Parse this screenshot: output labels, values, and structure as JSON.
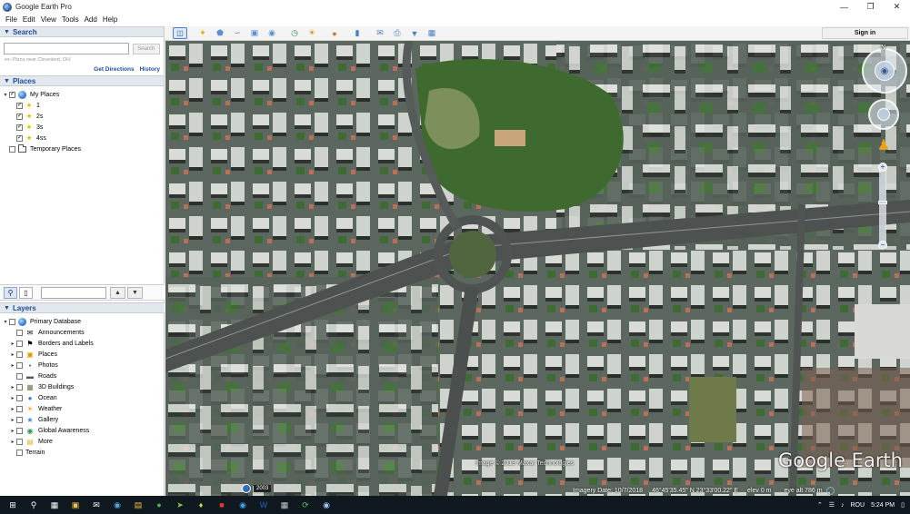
{
  "window": {
    "title": "Google Earth Pro",
    "controls": {
      "minimize": "—",
      "maximize": "❐",
      "close": "✕"
    }
  },
  "menu": [
    "File",
    "Edit",
    "View",
    "Tools",
    "Add",
    "Help"
  ],
  "search": {
    "header": "Search",
    "placeholder": "",
    "button": "Search",
    "hint": "ex: Pizza near Cleveland, OH",
    "get_directions": "Get Directions",
    "history": "History"
  },
  "places": {
    "header": "Places",
    "my_places": "My Places",
    "items": [
      {
        "label": "1",
        "checked": true
      },
      {
        "label": "2s",
        "checked": true
      },
      {
        "label": "3s",
        "checked": true
      },
      {
        "label": "4ss",
        "checked": true
      }
    ],
    "temporary": "Temporary Places"
  },
  "layers": {
    "header": "Layers",
    "primary": "Primary Database",
    "items": [
      {
        "label": "Announcements",
        "icon": "envelope-icon",
        "glyph": "✉"
      },
      {
        "label": "Borders and Labels",
        "icon": "flag-icon",
        "glyph": "⚑"
      },
      {
        "label": "Places",
        "icon": "places-icon",
        "glyph": "▣"
      },
      {
        "label": "Photos",
        "icon": "photo-icon",
        "glyph": "▪"
      },
      {
        "label": "Roads",
        "icon": "road-icon",
        "glyph": "▬"
      },
      {
        "label": "3D Buildings",
        "icon": "buildings-icon",
        "glyph": "▦"
      },
      {
        "label": "Ocean",
        "icon": "ocean-icon",
        "glyph": "●"
      },
      {
        "label": "Weather",
        "icon": "weather-icon",
        "glyph": "☀"
      },
      {
        "label": "Gallery",
        "icon": "gallery-icon",
        "glyph": "★"
      },
      {
        "label": "Global Awareness",
        "icon": "awareness-icon",
        "glyph": "◉"
      },
      {
        "label": "More",
        "icon": "folder-icon",
        "glyph": "▤"
      },
      {
        "label": "Terrain",
        "icon": "",
        "glyph": ""
      }
    ]
  },
  "toolbar": {
    "signin": "Sign in"
  },
  "map": {
    "watermark": "Google Earth",
    "copyright": "Image © 2019 Maxar Technologies",
    "year_badge": "2003",
    "imagery_date": "Imagery Date: 10/7/2018",
    "coordinates": "46°45'35.45\" N   23°33'00.22\" E",
    "elev": "elev   0 m",
    "eye_alt": "eye alt   786 m",
    "compass_n": "N"
  },
  "taskbar": {
    "lang": "ROU",
    "time": "5:24 PM"
  },
  "colors": {
    "panel_header_bg": "#e3e8ee",
    "panel_header_text": "#1c4c9c",
    "taskbar": "#101820"
  }
}
